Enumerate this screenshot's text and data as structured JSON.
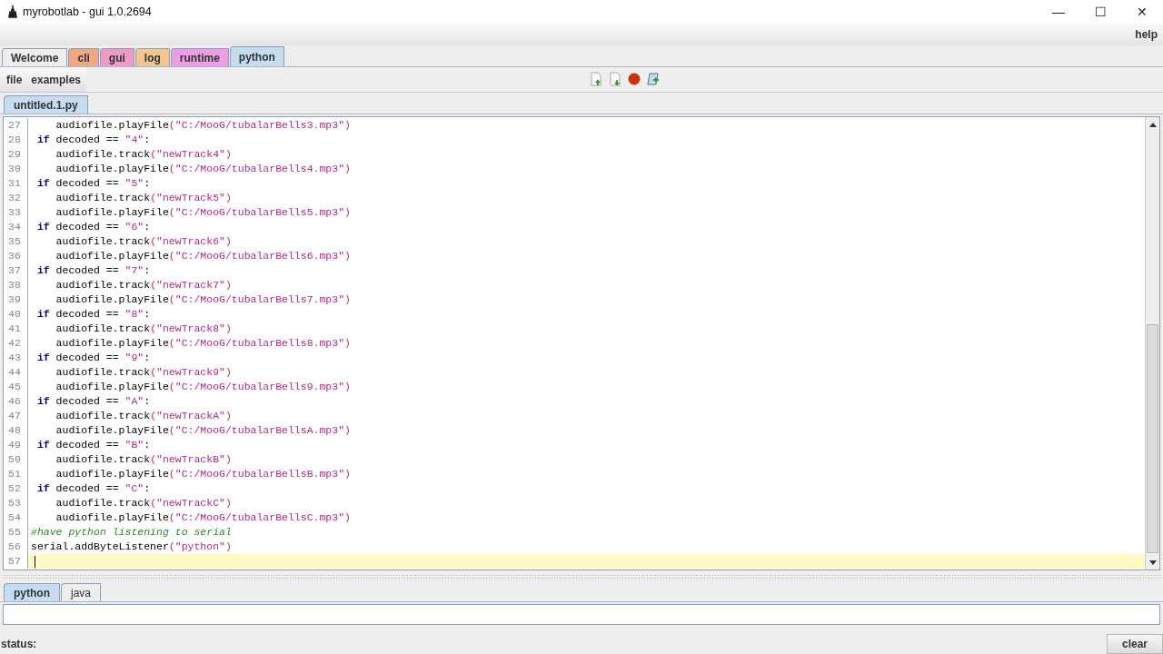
{
  "window": {
    "title": "myrobotlab - gui 1.0.2694",
    "controls": [
      "—",
      "☐",
      "✕"
    ]
  },
  "menu": [
    "help"
  ],
  "tabs": [
    {
      "label": "Welcome",
      "color": "#eeeeee",
      "selected": false
    },
    {
      "label": "cli",
      "color": "#f0a882",
      "selected": false
    },
    {
      "label": "gui",
      "color": "#f09ac8",
      "selected": false
    },
    {
      "label": "log",
      "color": "#f2c48e",
      "selected": false
    },
    {
      "label": "runtime",
      "color": "#ee9ee6",
      "selected": false
    },
    {
      "label": "python",
      "color": "#c6dcf0",
      "selected": true
    }
  ],
  "editor_menu": [
    "file",
    "examples"
  ],
  "file_tabs": [
    {
      "label": "untitled.1.py",
      "selected": true
    }
  ],
  "code_lines": [
    {
      "number": "27",
      "current": false,
      "segments": [
        {
          "kind": "plain",
          "text": "    audiofile.playFile"
        },
        {
          "kind": "paren",
          "text": "("
        },
        {
          "kind": "string",
          "text": "\"C:/MooG/tubalarBells3.mp3\""
        },
        {
          "kind": "paren",
          "text": ")"
        }
      ]
    },
    {
      "number": "28",
      "current": false,
      "segments": [
        {
          "kind": "keyword",
          "text": " if"
        },
        {
          "kind": "plain",
          "text": " decoded == "
        },
        {
          "kind": "string",
          "text": "\"4\""
        },
        {
          "kind": "plain",
          "text": ":"
        }
      ]
    },
    {
      "number": "29",
      "current": false,
      "segments": [
        {
          "kind": "plain",
          "text": "    audiofile.track"
        },
        {
          "kind": "paren",
          "text": "("
        },
        {
          "kind": "string",
          "text": "\"newTrack4\""
        },
        {
          "kind": "paren",
          "text": ")"
        }
      ]
    },
    {
      "number": "30",
      "current": false,
      "segments": [
        {
          "kind": "plain",
          "text": "    audiofile.playFile"
        },
        {
          "kind": "paren",
          "text": "("
        },
        {
          "kind": "string",
          "text": "\"C:/MooG/tubalarBells4.mp3\""
        },
        {
          "kind": "paren",
          "text": ")"
        }
      ]
    },
    {
      "number": "31",
      "current": false,
      "segments": [
        {
          "kind": "keyword",
          "text": " if"
        },
        {
          "kind": "plain",
          "text": " decoded == "
        },
        {
          "kind": "string",
          "text": "\"5\""
        },
        {
          "kind": "plain",
          "text": ":"
        }
      ]
    },
    {
      "number": "32",
      "current": false,
      "segments": [
        {
          "kind": "plain",
          "text": "    audiofile.track"
        },
        {
          "kind": "paren",
          "text": "("
        },
        {
          "kind": "string",
          "text": "\"newTrack5\""
        },
        {
          "kind": "paren",
          "text": ")"
        }
      ]
    },
    {
      "number": "33",
      "current": false,
      "segments": [
        {
          "kind": "plain",
          "text": "    audiofile.playFile"
        },
        {
          "kind": "paren",
          "text": "("
        },
        {
          "kind": "string",
          "text": "\"C:/MooG/tubalarBells5.mp3\""
        },
        {
          "kind": "paren",
          "text": ")"
        }
      ]
    },
    {
      "number": "34",
      "current": false,
      "segments": [
        {
          "kind": "keyword",
          "text": " if"
        },
        {
          "kind": "plain",
          "text": " decoded == "
        },
        {
          "kind": "string",
          "text": "\"6\""
        },
        {
          "kind": "plain",
          "text": ":"
        }
      ]
    },
    {
      "number": "35",
      "current": false,
      "segments": [
        {
          "kind": "plain",
          "text": "    audiofile.track"
        },
        {
          "kind": "paren",
          "text": "("
        },
        {
          "kind": "string",
          "text": "\"newTrack6\""
        },
        {
          "kind": "paren",
          "text": ")"
        }
      ]
    },
    {
      "number": "36",
      "current": false,
      "segments": [
        {
          "kind": "plain",
          "text": "    audiofile.playFile"
        },
        {
          "kind": "paren",
          "text": "("
        },
        {
          "kind": "string",
          "text": "\"C:/MooG/tubalarBells6.mp3\""
        },
        {
          "kind": "paren",
          "text": ")"
        }
      ]
    },
    {
      "number": "37",
      "current": false,
      "segments": [
        {
          "kind": "keyword",
          "text": " if"
        },
        {
          "kind": "plain",
          "text": " decoded == "
        },
        {
          "kind": "string",
          "text": "\"7\""
        },
        {
          "kind": "plain",
          "text": ":"
        }
      ]
    },
    {
      "number": "38",
      "current": false,
      "segments": [
        {
          "kind": "plain",
          "text": "    audiofile.track"
        },
        {
          "kind": "paren",
          "text": "("
        },
        {
          "kind": "string",
          "text": "\"newTrack7\""
        },
        {
          "kind": "paren",
          "text": ")"
        }
      ]
    },
    {
      "number": "39",
      "current": false,
      "segments": [
        {
          "kind": "plain",
          "text": "    audiofile.playFile"
        },
        {
          "kind": "paren",
          "text": "("
        },
        {
          "kind": "string",
          "text": "\"C:/MooG/tubalarBells7.mp3\""
        },
        {
          "kind": "paren",
          "text": ")"
        }
      ]
    },
    {
      "number": "40",
      "current": false,
      "segments": [
        {
          "kind": "keyword",
          "text": " if"
        },
        {
          "kind": "plain",
          "text": " decoded == "
        },
        {
          "kind": "string",
          "text": "\"8\""
        },
        {
          "kind": "plain",
          "text": ":"
        }
      ]
    },
    {
      "number": "41",
      "current": false,
      "segments": [
        {
          "kind": "plain",
          "text": "    audiofile.track"
        },
        {
          "kind": "paren",
          "text": "("
        },
        {
          "kind": "string",
          "text": "\"newTrack8\""
        },
        {
          "kind": "paren",
          "text": ")"
        }
      ]
    },
    {
      "number": "42",
      "current": false,
      "segments": [
        {
          "kind": "plain",
          "text": "    audiofile.playFile"
        },
        {
          "kind": "paren",
          "text": "("
        },
        {
          "kind": "string",
          "text": "\"C:/MooG/tubalarBells8.mp3\""
        },
        {
          "kind": "paren",
          "text": ")"
        }
      ]
    },
    {
      "number": "43",
      "current": false,
      "segments": [
        {
          "kind": "keyword",
          "text": " if"
        },
        {
          "kind": "plain",
          "text": " decoded == "
        },
        {
          "kind": "string",
          "text": "\"9\""
        },
        {
          "kind": "plain",
          "text": ":"
        }
      ]
    },
    {
      "number": "44",
      "current": false,
      "segments": [
        {
          "kind": "plain",
          "text": "    audiofile.track"
        },
        {
          "kind": "paren",
          "text": "("
        },
        {
          "kind": "string",
          "text": "\"newTrack9\""
        },
        {
          "kind": "paren",
          "text": ")"
        }
      ]
    },
    {
      "number": "45",
      "current": false,
      "segments": [
        {
          "kind": "plain",
          "text": "    audiofile.playFile"
        },
        {
          "kind": "paren",
          "text": "("
        },
        {
          "kind": "string",
          "text": "\"C:/MooG/tubalarBells9.mp3\""
        },
        {
          "kind": "paren",
          "text": ")"
        }
      ]
    },
    {
      "number": "46",
      "current": false,
      "segments": [
        {
          "kind": "keyword",
          "text": " if"
        },
        {
          "kind": "plain",
          "text": " decoded == "
        },
        {
          "kind": "string",
          "text": "\"A\""
        },
        {
          "kind": "plain",
          "text": ":"
        }
      ]
    },
    {
      "number": "47",
      "current": false,
      "segments": [
        {
          "kind": "plain",
          "text": "    audiofile.track"
        },
        {
          "kind": "paren",
          "text": "("
        },
        {
          "kind": "string",
          "text": "\"newTrackA\""
        },
        {
          "kind": "paren",
          "text": ")"
        }
      ]
    },
    {
      "number": "48",
      "current": false,
      "segments": [
        {
          "kind": "plain",
          "text": "    audiofile.playFile"
        },
        {
          "kind": "paren",
          "text": "("
        },
        {
          "kind": "string",
          "text": "\"C:/MooG/tubalarBellsA.mp3\""
        },
        {
          "kind": "paren",
          "text": ")"
        }
      ]
    },
    {
      "number": "49",
      "current": false,
      "segments": [
        {
          "kind": "keyword",
          "text": " if"
        },
        {
          "kind": "plain",
          "text": " decoded == "
        },
        {
          "kind": "string",
          "text": "\"B\""
        },
        {
          "kind": "plain",
          "text": ":"
        }
      ]
    },
    {
      "number": "50",
      "current": false,
      "segments": [
        {
          "kind": "plain",
          "text": "    audiofile.track"
        },
        {
          "kind": "paren",
          "text": "("
        },
        {
          "kind": "string",
          "text": "\"newTrackB\""
        },
        {
          "kind": "paren",
          "text": ")"
        }
      ]
    },
    {
      "number": "51",
      "current": false,
      "segments": [
        {
          "kind": "plain",
          "text": "    audiofile.playFile"
        },
        {
          "kind": "paren",
          "text": "("
        },
        {
          "kind": "string",
          "text": "\"C:/MooG/tubalarBellsB.mp3\""
        },
        {
          "kind": "paren",
          "text": ")"
        }
      ]
    },
    {
      "number": "52",
      "current": false,
      "segments": [
        {
          "kind": "keyword",
          "text": " if"
        },
        {
          "kind": "plain",
          "text": " decoded == "
        },
        {
          "kind": "string",
          "text": "\"C\""
        },
        {
          "kind": "plain",
          "text": ":"
        }
      ]
    },
    {
      "number": "53",
      "current": false,
      "segments": [
        {
          "kind": "plain",
          "text": "    audiofile.track"
        },
        {
          "kind": "paren",
          "text": "("
        },
        {
          "kind": "string",
          "text": "\"newTrackC\""
        },
        {
          "kind": "paren",
          "text": ")"
        }
      ]
    },
    {
      "number": "54",
      "current": false,
      "segments": [
        {
          "kind": "plain",
          "text": "    audiofile.playFile"
        },
        {
          "kind": "paren",
          "text": "("
        },
        {
          "kind": "string",
          "text": "\"C:/MooG/tubalarBellsC.mp3\""
        },
        {
          "kind": "paren",
          "text": ")"
        }
      ]
    },
    {
      "number": "55",
      "current": false,
      "segments": [
        {
          "kind": "comment",
          "text": "#have python listening to serial"
        }
      ]
    },
    {
      "number": "56",
      "current": false,
      "segments": [
        {
          "kind": "plain",
          "text": "serial.addByteListener"
        },
        {
          "kind": "paren",
          "text": "("
        },
        {
          "kind": "string",
          "text": "\"python\""
        },
        {
          "kind": "paren",
          "text": ")"
        }
      ]
    },
    {
      "number": "57",
      "current": true
    }
  ],
  "console_tabs": [
    {
      "label": "python",
      "selected": true
    },
    {
      "label": "java",
      "selected": false
    }
  ],
  "status_bar": {
    "label": "status:",
    "button": "clear"
  }
}
